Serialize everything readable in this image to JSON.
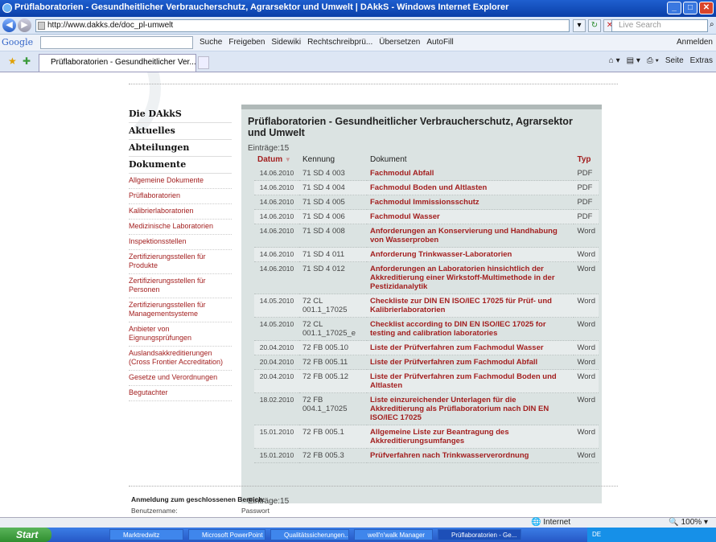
{
  "window": {
    "title": "Prüflaboratorien - Gesundheitlicher Verbraucherschutz, Agrarsektor und Umwelt | DAkkS - Windows Internet Explorer"
  },
  "addressbar": {
    "url": "http://www.dakks.de/doc_pl-umwelt",
    "search_placeholder": "Live Search"
  },
  "google_toolbar": {
    "logo": "Google",
    "items": [
      "Suche",
      "Freigeben",
      "Sidewiki",
      "Rechtschreibprü...",
      "Übersetzen",
      "AutoFill"
    ],
    "right": "Anmelden"
  },
  "tabs": [
    {
      "label": "Prüflaboratorien - Gesundheitlicher Ver..."
    }
  ],
  "commandbar": [
    "Seite",
    "Extras"
  ],
  "leftnav": {
    "main": [
      "Die DAkkS",
      "Aktuelles",
      "Abteilungen",
      "Dokumente"
    ],
    "sub": [
      "Allgemeine Dokumente",
      "Prüflaboratorien",
      "Kalibrierlaboratorien",
      "Medizinische Laboratorien",
      "Inspektionsstellen",
      "Zertifizierungsstellen für Produkte",
      "Zertifizierungsstellen für Personen",
      "Zertifizierungsstellen für Managementsysteme",
      "Anbieter von Eignungsprüfungen",
      "Auslandsakkreditierungen (Cross Frontier Accreditation)",
      "Gesetze und Verordnungen",
      "Begutachter"
    ]
  },
  "panel": {
    "title": "Prüflaboratorien - Gesundheitlicher Verbraucherschutz, Agrarsektor und Umwelt",
    "count_top": "Einträge:15",
    "count_bottom": "Einträge:15",
    "headers": {
      "datum": "Datum",
      "kennung": "Kennung",
      "dokument": "Dokument",
      "typ": "Typ"
    },
    "rows": [
      {
        "datum": "14.06.2010",
        "kennung": "71 SD 4 003",
        "dokument": "Fachmodul Abfall",
        "typ": "PDF"
      },
      {
        "datum": "14.06.2010",
        "kennung": "71 SD 4 004",
        "dokument": "Fachmodul Boden und Altlasten",
        "typ": "PDF"
      },
      {
        "datum": "14.06.2010",
        "kennung": "71 SD 4 005",
        "dokument": "Fachmodul Immissionsschutz",
        "typ": "PDF"
      },
      {
        "datum": "14.06.2010",
        "kennung": "71 SD 4 006",
        "dokument": "Fachmodul Wasser",
        "typ": "PDF"
      },
      {
        "datum": "14.06.2010",
        "kennung": "71 SD 4 008",
        "dokument": "Anforderungen an Konservierung und Handhabung von Wasserproben",
        "typ": "Word"
      },
      {
        "datum": "14.06.2010",
        "kennung": "71 SD 4 011",
        "dokument": "Anforderung Trinkwasser-Laboratorien",
        "typ": "Word"
      },
      {
        "datum": "14.06.2010",
        "kennung": "71 SD 4 012",
        "dokument": "Anforderungen an Laboratorien hinsichtlich der Akkreditierung einer Wirkstoff-Multimethode in der Pestizidanalytik",
        "typ": "Word"
      },
      {
        "datum": "14.05.2010",
        "kennung": "72 CL 001.1_17025",
        "dokument": "Checkliste zur DIN EN ISO/IEC 17025 für Prüf- und Kalibrierlaboratorien",
        "typ": "Word"
      },
      {
        "datum": "14.05.2010",
        "kennung": "72 CL 001.1_17025_e",
        "dokument": "Checklist according to DIN EN ISO/IEC 17025 for testing and calibration laboratories",
        "typ": "Word"
      },
      {
        "datum": "20.04.2010",
        "kennung": "72 FB 005.10",
        "dokument": "Liste der Prüfverfahren zum Fachmodul Wasser",
        "typ": "Word"
      },
      {
        "datum": "20.04.2010",
        "kennung": "72 FB 005.11",
        "dokument": "Liste der Prüfverfahren zum Fachmodul Abfall",
        "typ": "Word"
      },
      {
        "datum": "20.04.2010",
        "kennung": "72 FB 005.12",
        "dokument": "Liste der Prüfverfahren zum Fachmodul Boden und Altlasten",
        "typ": "Word"
      },
      {
        "datum": "18.02.2010",
        "kennung": "72 FB 004.1_17025",
        "dokument": "Liste einzureichender Unterlagen für die Akkreditierung als Prüflaboratorium nach DIN EN ISO/IEC 17025",
        "typ": "Word"
      },
      {
        "datum": "15.01.2010",
        "kennung": "72 FB 005.1",
        "dokument": "Allgemeine Liste zur Beantragung des Akkreditierungsumfanges",
        "typ": "Word"
      },
      {
        "datum": "15.01.2010",
        "kennung": "72 FB 005.3",
        "dokument": "Prüfverfahren nach Trinkwasserverordnung",
        "typ": "Word"
      }
    ]
  },
  "login": {
    "title": "Anmeldung zum geschlossenen Bereich:",
    "user_label": "Benutzername:",
    "pass_label": "Passwort"
  },
  "statusbar": {
    "zone": "Internet",
    "zoom": "100%"
  },
  "taskbar": {
    "start": "Start",
    "items": [
      "Marktredwitz",
      "Microsoft PowerPoint ...",
      "Qualitätssicherungen...",
      "well'n'walk Manager",
      "Prüflaboratorien - Ge..."
    ],
    "tray_lang": "DE"
  }
}
